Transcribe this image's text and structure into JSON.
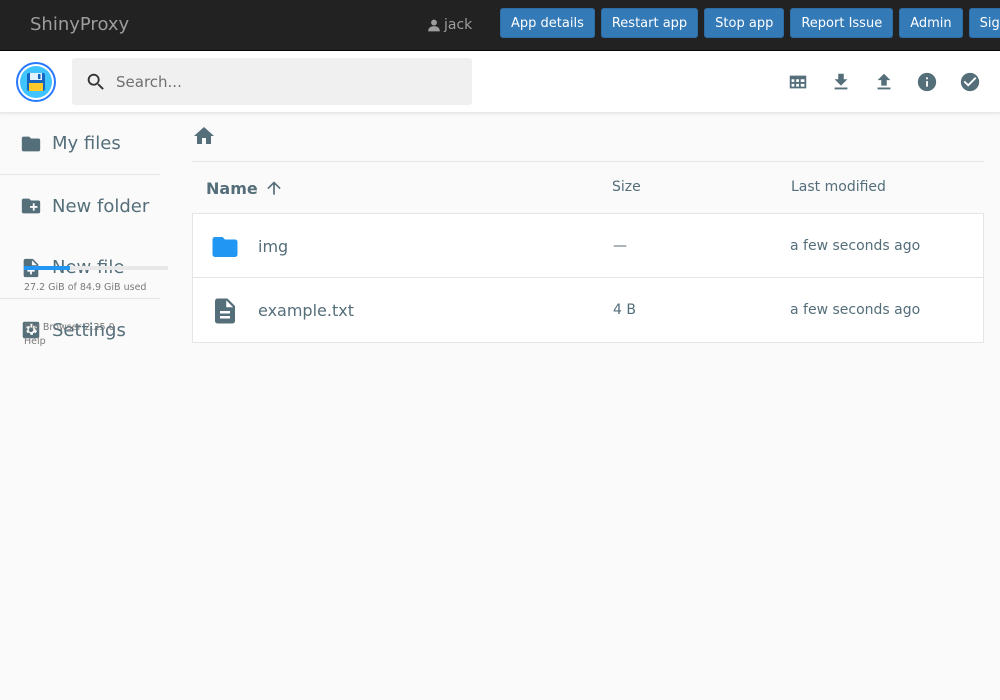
{
  "navbar": {
    "brand": "ShinyProxy",
    "user": "jack",
    "buttons": [
      "App details",
      "Restart app",
      "Stop app",
      "Report Issue",
      "Admin",
      "Sign Out"
    ]
  },
  "header": {
    "search_placeholder": "Search...",
    "actions": [
      "grid-view-icon",
      "download-icon",
      "upload-icon",
      "info-icon",
      "select-check-icon"
    ]
  },
  "sidebar": {
    "items": [
      {
        "label": "My files",
        "icon": "folder-icon"
      },
      {
        "label": "New folder",
        "icon": "create-folder-icon"
      },
      {
        "label": "New file",
        "icon": "note-add-icon"
      },
      {
        "label": "Settings",
        "icon": "settings-icon"
      }
    ],
    "usage_fraction": 0.32,
    "usage_text": "27.2 GiB of 84.9 GiB used",
    "version": "File Browser 2.25.0",
    "help": "Help"
  },
  "listing": {
    "columns": {
      "name": "Name",
      "size": "Size",
      "modified": "Last modified"
    },
    "rows": [
      {
        "name": "img",
        "size": "—",
        "modified": "a few seconds ago",
        "type": "folder"
      },
      {
        "name": "example.txt",
        "size": "4 B",
        "modified": "a few seconds ago",
        "type": "file"
      }
    ]
  },
  "colors": {
    "navbar_bg": "#222222",
    "nav_button": "#337ab7",
    "accent": "#2196f3",
    "icon": "#546e7a"
  }
}
